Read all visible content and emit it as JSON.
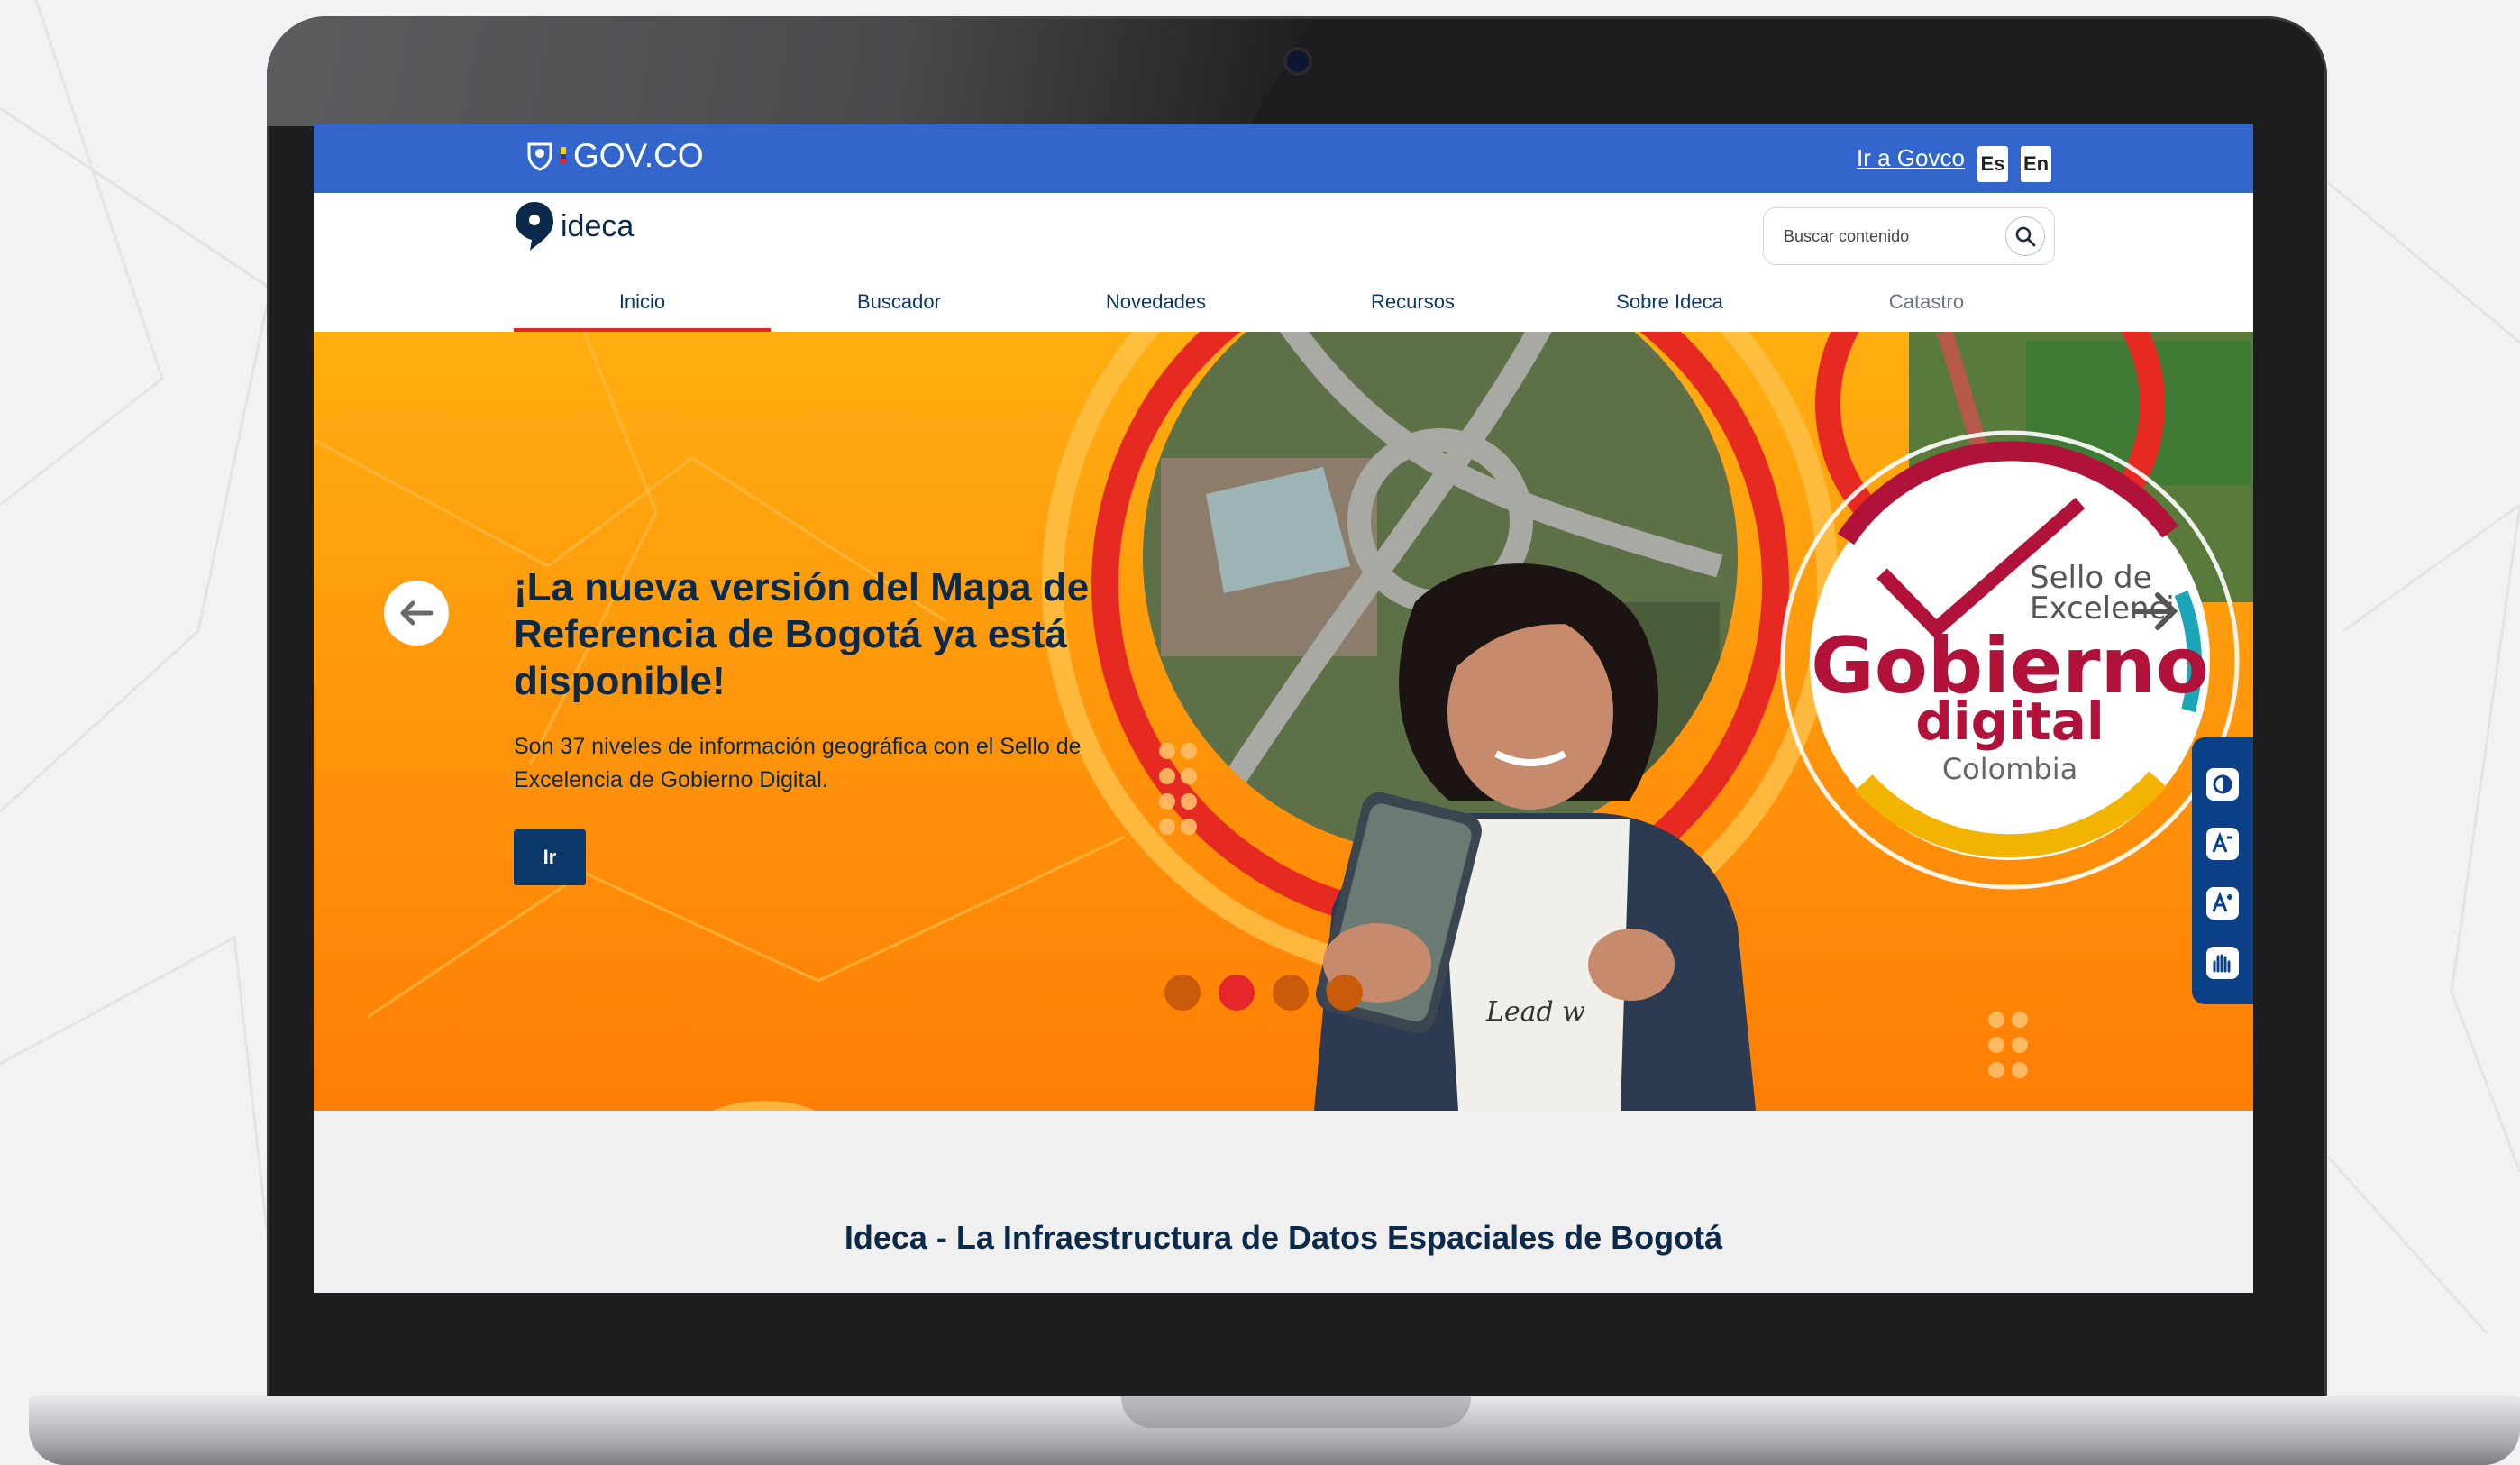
{
  "gov_bar": {
    "logo_text": "GOV.CO",
    "link_text": "Ir a Govco",
    "lang_es": "Es",
    "lang_en": "En"
  },
  "header": {
    "brand": "ideca",
    "search": {
      "placeholder": "Buscar contenido",
      "value": ""
    },
    "nav": [
      "Inicio",
      "Buscador",
      "Novedades",
      "Recursos",
      "Sobre Ideca",
      "Catastro"
    ],
    "active_tab": "Inicio"
  },
  "hero": {
    "title": "¡La nueva versión del Mapa de Referencia de Bogotá ya está disponible!",
    "subtitle": "Son 37 niveles de información geográfica con el Sello de Excelencia de Gobierno Digital.",
    "button_label": "Ir",
    "slide_count": 4,
    "active_slide": 2,
    "seal": {
      "line1": "Sello de",
      "line2": "Excelenci",
      "word1": "Gobierno",
      "word2": "digital",
      "country": "Colombia"
    },
    "shirt_text": "Lead w"
  },
  "accessibility_toolbar": [
    "contrast-icon",
    "font-decrease-icon",
    "font-increase-icon",
    "sign-language-icon"
  ],
  "section_title": "Ideca - La Infraestructura de Datos Espaciales de Bogotá",
  "colors": {
    "gov_blue": "#3366cc",
    "navy": "#0b2a4a",
    "orange": "#ff9a0c",
    "accent_red": "#e4262c"
  }
}
